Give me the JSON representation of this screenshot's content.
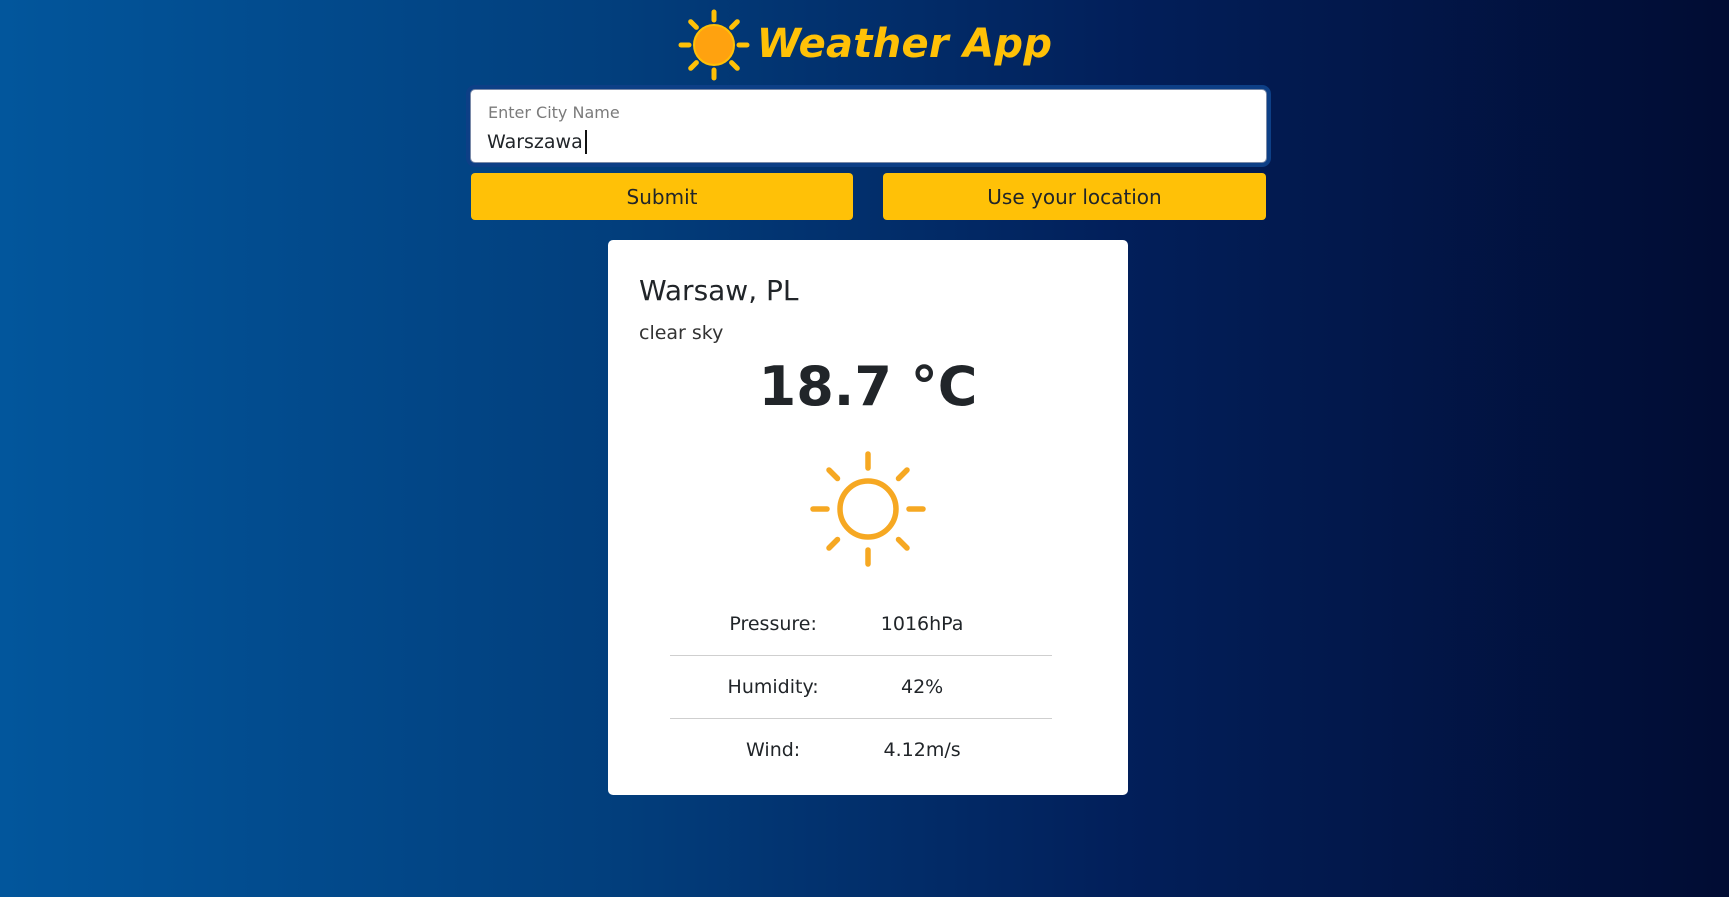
{
  "app": {
    "title": "Weather App",
    "accent_color": "#ffc107",
    "logo_icon": "sun-icon"
  },
  "search": {
    "label": "Enter City Name",
    "value": "Warszawa"
  },
  "buttons": {
    "submit": "Submit",
    "location": "Use your location"
  },
  "weather": {
    "city": "Warsaw, PL",
    "description": "clear sky",
    "temperature": "18.7 °C",
    "icon": "sun-outline-icon",
    "stats": [
      {
        "label": "Pressure:",
        "value": "1016hPa"
      },
      {
        "label": "Humidity:",
        "value": "42%"
      },
      {
        "label": "Wind:",
        "value": "4.12m/s"
      }
    ]
  }
}
